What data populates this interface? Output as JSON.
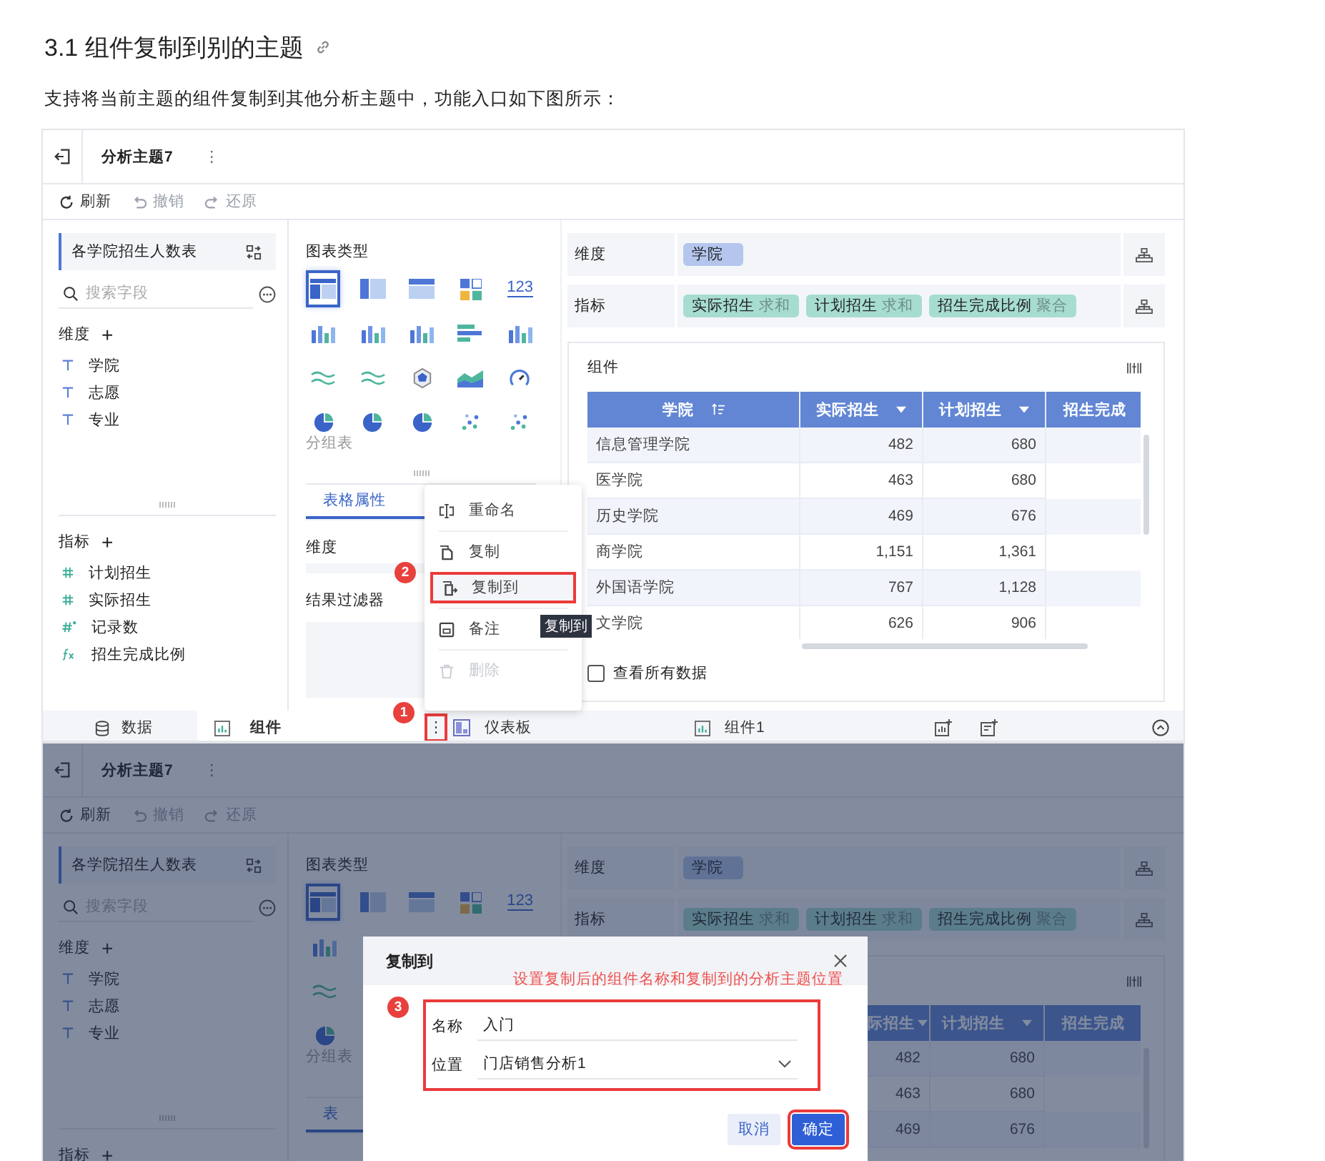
{
  "heading": {
    "title": "3.1 组件复制到别的主题"
  },
  "intro": "支持将当前主题的组件复制到其他分析主题中，功能入口如下图所示：",
  "screens": [
    {
      "topbar": {
        "title": "分析主题7",
        "menu": "⋮"
      },
      "toolbar": [
        {
          "label": "刷新",
          "kind": "refresh",
          "disabled": false
        },
        {
          "label": "撤销",
          "kind": "undo",
          "disabled": true
        },
        {
          "label": "还原",
          "kind": "redo",
          "disabled": true
        }
      ],
      "dataset": "各学院招生人数表",
      "search": {
        "placeholder": "搜索字段"
      },
      "dimensions": {
        "title": "维度",
        "add": "+",
        "items": [
          "学院",
          "志愿",
          "专业"
        ]
      },
      "measures": {
        "title": "指标",
        "add": "+",
        "items": [
          {
            "label": "计划招生",
            "kind": "number"
          },
          {
            "label": "实际招生",
            "kind": "number"
          },
          {
            "label": "记录数",
            "kind": "count"
          },
          {
            "label": "招生完成比例",
            "kind": "formula"
          }
        ]
      },
      "chart_panel": {
        "title": "图表类型",
        "rows": [
          [
            {
              "kind": "table",
              "selected": true
            },
            {
              "kind": "pivot",
              "selected": false
            },
            {
              "kind": "crosstab",
              "selected": false
            },
            {
              "kind": "tiles",
              "selected": false
            },
            {
              "kind": "number",
              "text": "123",
              "selected": false
            }
          ],
          [
            {
              "kind": "column",
              "selected": false
            },
            {
              "kind": "column",
              "selected": false
            },
            {
              "kind": "column",
              "selected": false
            },
            {
              "kind": "hbar",
              "selected": false
            },
            {
              "kind": "column",
              "selected": false
            }
          ],
          [
            {
              "kind": "line",
              "selected": false
            },
            {
              "kind": "line",
              "selected": false
            },
            {
              "kind": "radar",
              "selected": false
            },
            {
              "kind": "area",
              "selected": false
            },
            {
              "kind": "gauge",
              "selected": false
            }
          ],
          [
            {
              "kind": "pie",
              "selected": false
            },
            {
              "kind": "pie",
              "selected": false
            },
            {
              "kind": "pie",
              "selected": false
            },
            {
              "kind": "scatter",
              "selected": false
            },
            {
              "kind": "scatter",
              "selected": false
            }
          ]
        ],
        "hover_label": "分组表"
      },
      "props": {
        "tabs": [
          {
            "label": "表格属性",
            "selected": true
          }
        ],
        "sections": [
          "维度",
          "结果过滤器"
        ]
      },
      "context_menu": {
        "badge": "2",
        "items": [
          {
            "label": "重命名",
            "kind": "rename",
            "disabled": false,
            "highlighted": false
          },
          {
            "label": "复制",
            "kind": "copy",
            "disabled": false,
            "highlighted": false
          },
          {
            "label": "复制到",
            "kind": "copy-to",
            "disabled": false,
            "highlighted": true
          },
          {
            "label": "备注",
            "kind": "note",
            "disabled": false,
            "highlighted": false
          },
          {
            "label": "删除",
            "kind": "delete",
            "disabled": true,
            "highlighted": false
          }
        ],
        "tooltip": "复制到"
      },
      "dimension_row": {
        "label": "维度",
        "chips": [
          {
            "label": "学院"
          }
        ]
      },
      "measure_row": {
        "label": "指标",
        "chips": [
          {
            "label": "实际招生",
            "agg": "求和"
          },
          {
            "label": "计划招生",
            "agg": "求和"
          },
          {
            "label": "招生完成比例",
            "agg": "聚合"
          }
        ]
      },
      "component": {
        "title": "组件",
        "columns": [
          {
            "label": "学院",
            "kind": "text",
            "sort_icon": true
          },
          {
            "label": "实际招生",
            "kind": "number",
            "menu_caret": true
          },
          {
            "label": "计划招生",
            "kind": "number",
            "menu_caret": true
          },
          {
            "label": "招生完成",
            "kind": "number"
          }
        ],
        "rows": [
          [
            "信息管理学院",
            "482",
            "680"
          ],
          [
            "医学院",
            "463",
            "680"
          ],
          [
            "历史学院",
            "469",
            "676"
          ],
          [
            "商学院",
            "1,151",
            "1,361"
          ],
          [
            "外国语学院",
            "767",
            "1,128"
          ],
          [
            "文学院",
            "626",
            "906"
          ]
        ],
        "show_all": {
          "label": "查看所有数据",
          "checked": false
        }
      },
      "bottom_tabs": [
        {
          "label": "数据",
          "kind": "data",
          "selected": false
        },
        {
          "label": "组件",
          "kind": "component",
          "selected": true,
          "menu": "⋮",
          "badge": "1"
        },
        {
          "label": "仪表板",
          "kind": "dashboard",
          "selected": false
        },
        {
          "label": "组件1",
          "kind": "component",
          "selected": false
        }
      ]
    },
    {
      "topbar": {
        "title": "分析主题7",
        "menu": "⋮"
      },
      "toolbar": [
        {
          "label": "刷新",
          "kind": "refresh",
          "disabled": false
        },
        {
          "label": "撤销",
          "kind": "undo",
          "disabled": true
        },
        {
          "label": "还原",
          "kind": "redo",
          "disabled": true
        }
      ],
      "dataset": "各学院招生人数表",
      "search": {
        "placeholder": "搜索字段"
      },
      "dimensions": {
        "title": "维度",
        "add": "+",
        "items": [
          "学院",
          "志愿",
          "专业"
        ]
      },
      "measures": {
        "title": "指标",
        "add": "+"
      },
      "chart_panel": {
        "title": "图表类型",
        "rows": [
          [
            {
              "kind": "table",
              "selected": true
            },
            {
              "kind": "pivot",
              "selected": false
            },
            {
              "kind": "crosstab",
              "selected": false
            },
            {
              "kind": "tiles",
              "selected": false
            },
            {
              "kind": "number",
              "text": "123",
              "selected": false
            }
          ],
          [
            {
              "kind": "column",
              "selected": false
            }
          ],
          [
            {
              "kind": "line",
              "selected": false
            }
          ],
          [
            {
              "kind": "pie",
              "selected": false
            }
          ]
        ],
        "hover_label": "分组表"
      },
      "props": {
        "tabs": [
          {
            "label": "表",
            "selected": true
          }
        ]
      },
      "dimension_row": {
        "label": "维度",
        "chips": [
          {
            "label": "学院"
          }
        ]
      },
      "measure_row": {
        "label": "指标",
        "chips": [
          {
            "label": "实际招生",
            "agg": "求和"
          },
          {
            "label": "计划招生",
            "agg": "求和"
          },
          {
            "label": "招生完成比例",
            "agg": "聚合"
          }
        ]
      },
      "component": {
        "columns": [
          {
            "label": "际招生",
            "kind": "number",
            "menu_caret": true
          },
          {
            "label": "计划招生",
            "kind": "number",
            "menu_caret": true
          },
          {
            "label": "招生完成",
            "kind": "number"
          }
        ],
        "rows": [
          [
            "482",
            "680"
          ],
          [
            "463",
            "680"
          ],
          [
            "469",
            "676"
          ]
        ]
      },
      "dialog": {
        "title": "复制到",
        "note": "设置复制后的组件名称和复制到的分析主题位置",
        "badge": "3",
        "fields": [
          {
            "label": "名称",
            "value": "入门",
            "kind": "text"
          },
          {
            "label": "位置",
            "value": "门店销售分析1",
            "kind": "select"
          }
        ],
        "buttons": [
          {
            "label": "取消",
            "kind": "secondary",
            "highlighted": false
          },
          {
            "label": "确定",
            "kind": "primary",
            "highlighted": true
          }
        ]
      }
    }
  ]
}
